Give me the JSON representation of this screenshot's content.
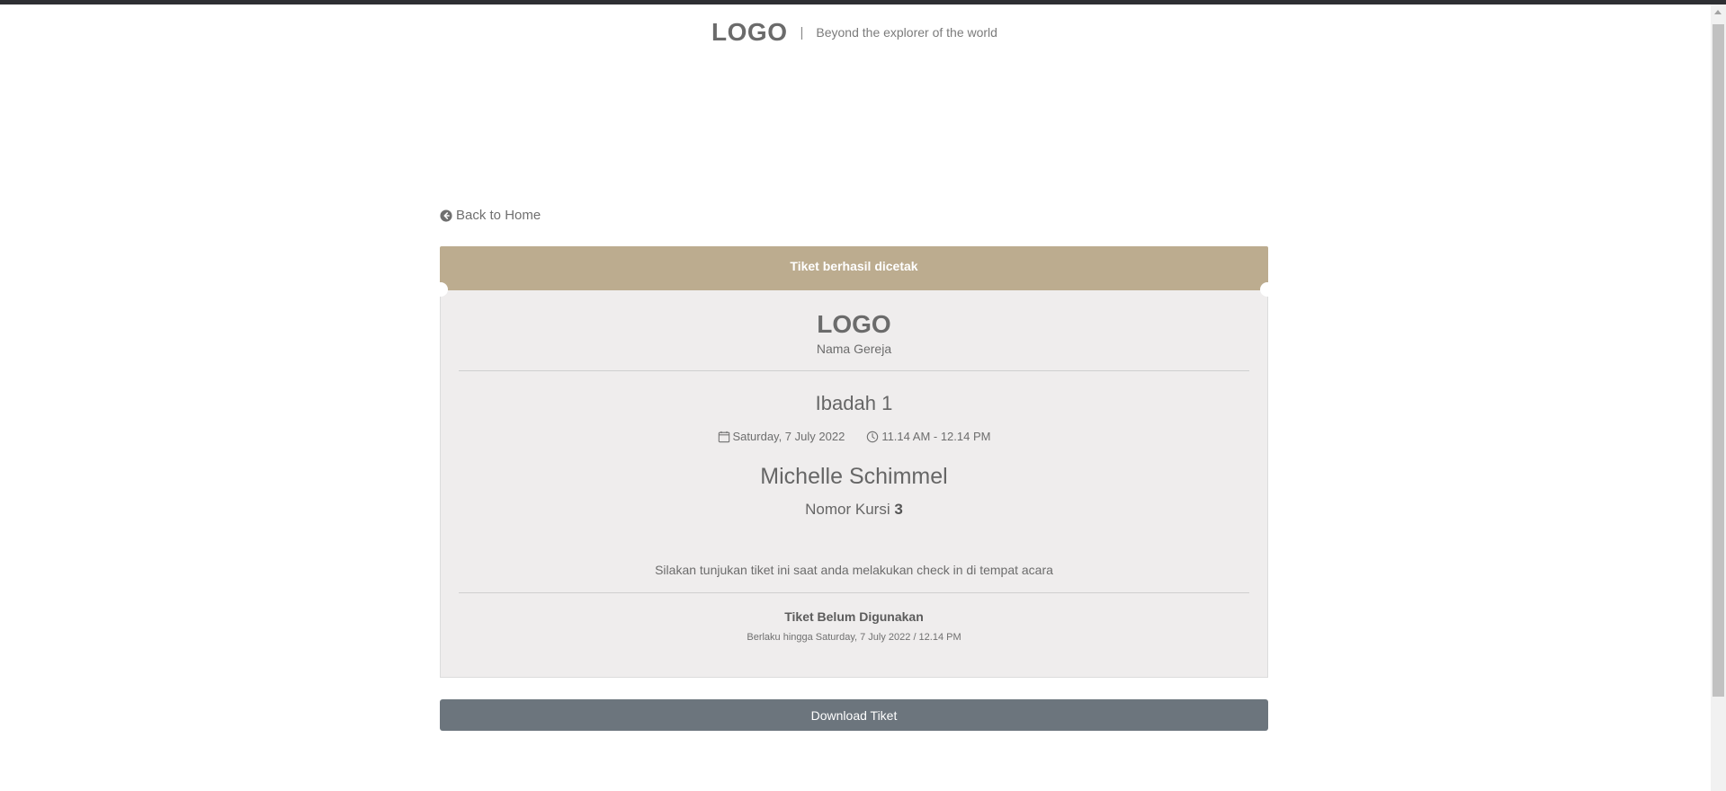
{
  "header": {
    "logo": "LOGO",
    "separator": "|",
    "tagline": "Beyond the explorer of the world"
  },
  "nav": {
    "back_label": "Back to Home",
    "back_icon": "arrow-circle-left-icon"
  },
  "ticket": {
    "banner": "Tiket berhasil dicetak",
    "logo": "LOGO",
    "church_name": "Nama Gereja",
    "event_name": "Ibadah 1",
    "date": "Saturday, 7 July 2022",
    "date_icon": "calendar-icon",
    "time": "11.14 AM - 12.14 PM",
    "time_icon": "clock-icon",
    "attendee_name": "Michelle Schimmel",
    "seat_label": "Nomor Kursi",
    "seat_number": "3",
    "instruction": "Silakan tunjukan tiket ini saat anda melakukan check in di tempat acara",
    "status": "Tiket Belum Digunakan",
    "validity": "Berlaku hingga Saturday, 7 July 2022 / 12.14 PM"
  },
  "actions": {
    "download_label": "Download Tiket"
  },
  "colors": {
    "banner": "#bcac8f",
    "ticket_bg": "#efeded",
    "button": "#6c757d",
    "topbar": "#2e2f33"
  }
}
